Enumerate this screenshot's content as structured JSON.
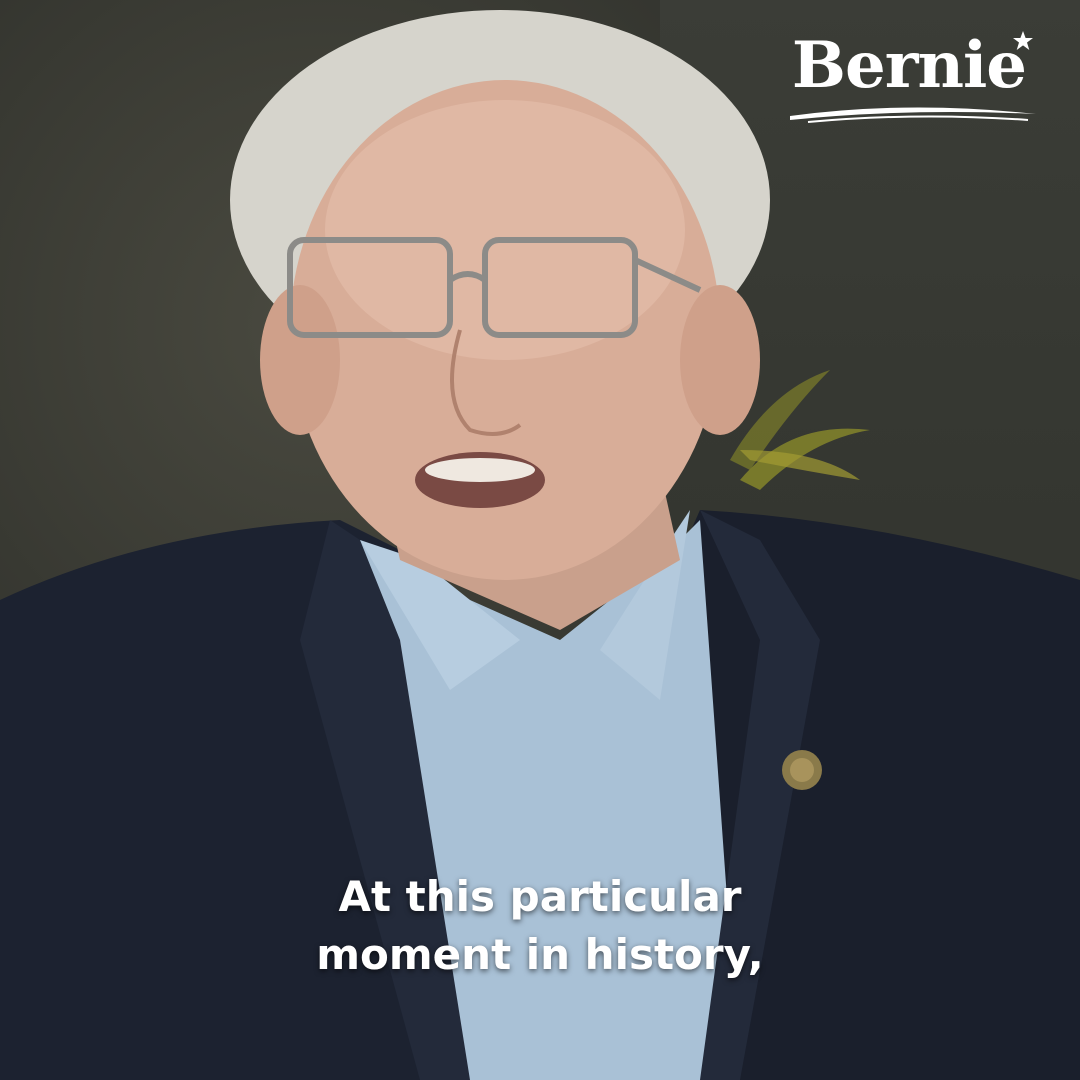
{
  "brand": {
    "logo_text": "Bernie",
    "logo_color": "#ffffff"
  },
  "caption": {
    "line1": "At this particular",
    "line2": "moment in history,",
    "color": "#ffffff"
  },
  "scene": {
    "description_icons": [
      "person-photo",
      "plant-leaves",
      "lapel-pin"
    ],
    "shirt_color": "#a9c1d6",
    "jacket_color": "#1c2230"
  }
}
